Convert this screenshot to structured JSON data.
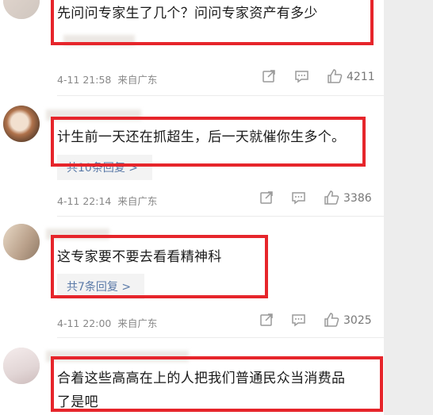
{
  "comments": [
    {
      "text_lines": [
        "先问问专家生了几个？问问专家资产有多少"
      ],
      "date": "4-11 21:58",
      "source": "来自广东",
      "likes": "4211"
    },
    {
      "text_lines": [
        "计生前一天还在抓超生，后一天就催你生多个。"
      ],
      "replies": "共10条回复 >",
      "date": "4-11 22:14",
      "source": "来自广东",
      "likes": "3386"
    },
    {
      "text_lines": [
        "这专家要不要去看看精神科"
      ],
      "replies": "共7条回复 >",
      "date": "4-11 22:00",
      "source": "来自广东",
      "likes": "3025"
    },
    {
      "text_lines": [
        "合着这些高高在上的人把我们普通民众当消费品",
        "了是吧"
      ]
    }
  ],
  "icons": {
    "share": "share-icon",
    "comment": "comment-icon",
    "like": "thumbs-up-icon"
  },
  "colors": {
    "highlight": "#e6252b",
    "link": "#5b7aa8",
    "meta": "#888888"
  }
}
